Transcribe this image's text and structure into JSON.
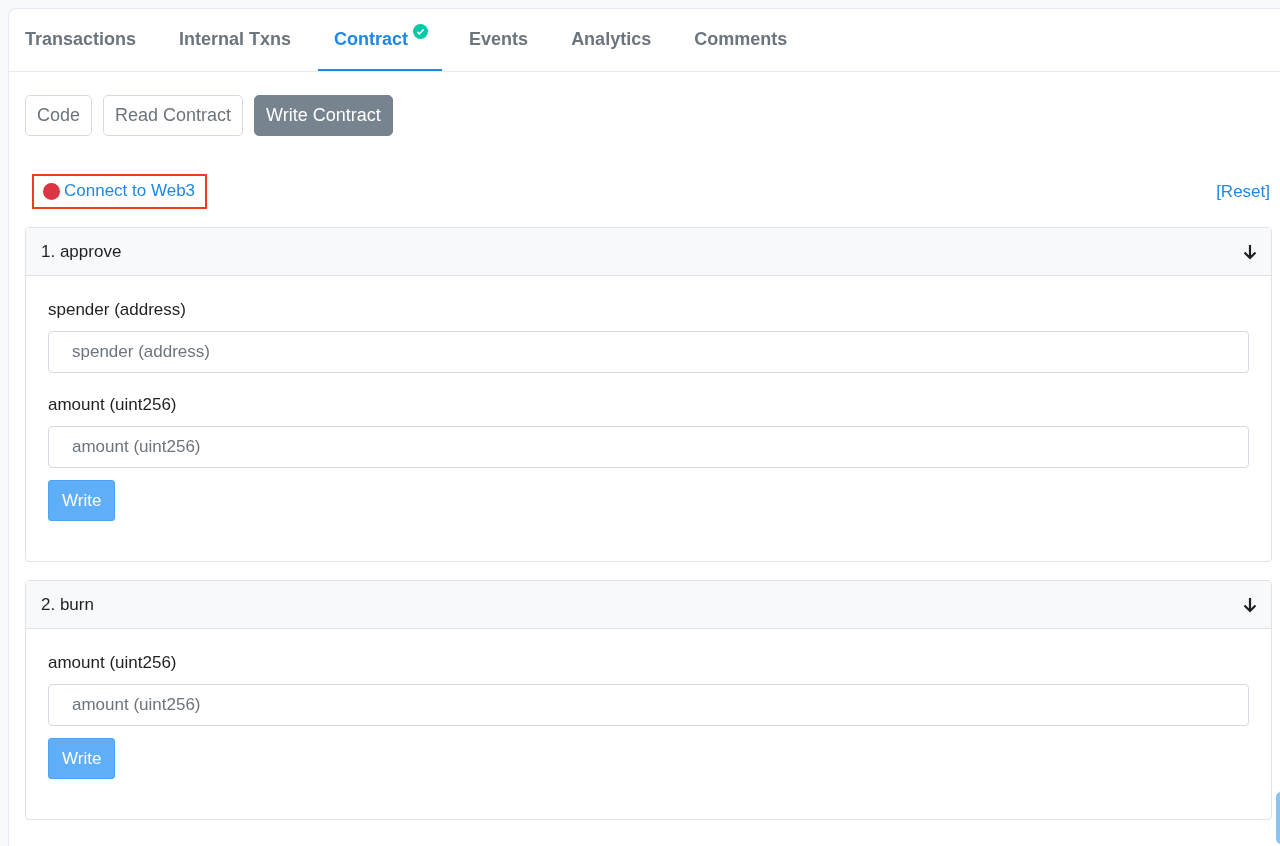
{
  "tabs": [
    {
      "label": "Transactions",
      "selected": false,
      "verified": false
    },
    {
      "label": "Internal Txns",
      "selected": false,
      "verified": false
    },
    {
      "label": "Contract",
      "selected": true,
      "verified": true
    },
    {
      "label": "Events",
      "selected": false,
      "verified": false
    },
    {
      "label": "Analytics",
      "selected": false,
      "verified": false
    },
    {
      "label": "Comments",
      "selected": false,
      "verified": false
    }
  ],
  "subtabs": [
    {
      "label": "Code",
      "selected": false
    },
    {
      "label": "Read Contract",
      "selected": false
    },
    {
      "label": "Write Contract",
      "selected": true
    }
  ],
  "connect": {
    "label": "Connect to Web3",
    "connected": false
  },
  "reset": "[Reset]",
  "functions": [
    {
      "title": "1. approve",
      "expanded": true,
      "inputs": [
        {
          "label": "spender (address)",
          "placeholder": "spender (address)"
        },
        {
          "label": "amount (uint256)",
          "placeholder": "amount (uint256)"
        }
      ],
      "button": "Write"
    },
    {
      "title": "2. burn",
      "expanded": true,
      "inputs": [
        {
          "label": "amount (uint256)",
          "placeholder": "amount (uint256)"
        }
      ],
      "button": "Write"
    }
  ]
}
